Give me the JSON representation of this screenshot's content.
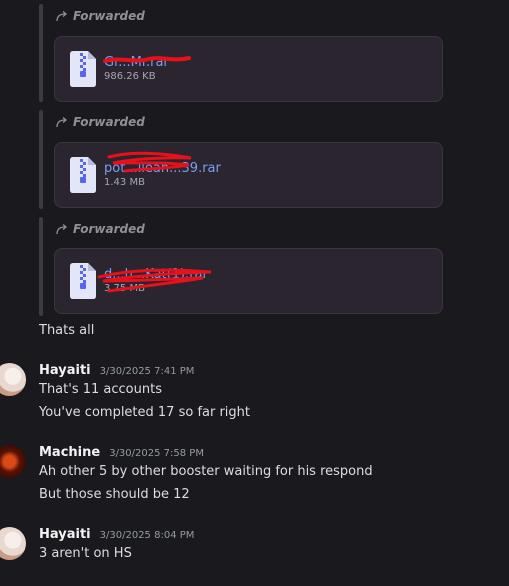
{
  "forwarded_messages": [
    {
      "label": "Forwarded",
      "file_name": "Gr...Mr.rar",
      "file_size": "986.26 KB"
    },
    {
      "label": "Forwarded",
      "file_name": "pot...llean...39.rar",
      "file_size": "1.43 MB"
    },
    {
      "label": "Forwarded",
      "file_name": "d...h...Kat(1).rar",
      "file_size": "3.75 MB"
    }
  ],
  "continuation": {
    "text": "Thats all"
  },
  "messages": [
    {
      "author": "Hayaiti",
      "timestamp": "3/30/2025 7:41 PM",
      "lines": [
        "That's 11 accounts",
        "You've completed 17 so far right"
      ]
    },
    {
      "author": "Machine",
      "timestamp": "3/30/2025 7:58 PM",
      "lines": [
        "Ah other 5 by other booster waiting for his respond",
        "But those should be 12"
      ]
    },
    {
      "author": "Hayaiti",
      "timestamp": "3/30/2025 8:04 PM",
      "lines": [
        "3 aren't on HS"
      ]
    }
  ],
  "colors": {
    "background": "#1a1a1e",
    "attachment_bg": "#2b2530",
    "file_link": "#7a9ff0",
    "redaction": "#e8101a"
  }
}
